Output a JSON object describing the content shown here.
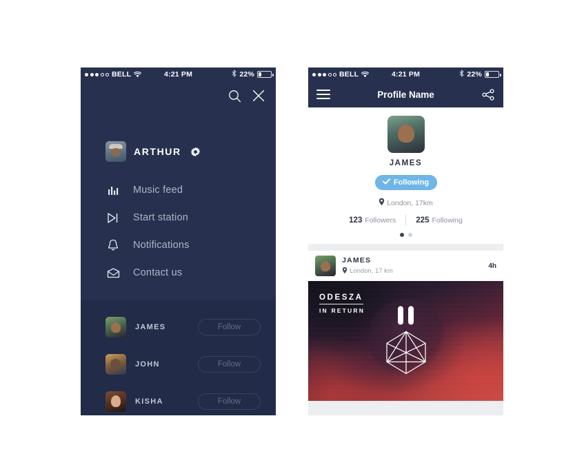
{
  "status_bar": {
    "signal_dots_filled": 3,
    "signal_dots_total": 5,
    "carrier": "BELL",
    "time": "4:21 PM",
    "battery_percent": "22%",
    "wifi_icon": "wifi-icon",
    "bluetooth_icon": "bluetooth-icon",
    "battery_icon": "battery-icon"
  },
  "menu_screen": {
    "search_icon": "search-icon",
    "close_icon": "close-icon",
    "user": {
      "name": "ARTHUR",
      "avatar": "arthur-avatar",
      "settings_icon": "gear-icon"
    },
    "nav_items": [
      {
        "label": "Music feed",
        "icon": "equalizer-icon"
      },
      {
        "label": "Start station",
        "icon": "play-next-icon"
      },
      {
        "label": "Notifications",
        "icon": "bell-icon"
      },
      {
        "label": "Contact us",
        "icon": "envelope-icon"
      }
    ],
    "suggestions": [
      {
        "name": "JAMES",
        "button": "Follow",
        "avatar": "james-avatar"
      },
      {
        "name": "JOHN",
        "button": "Follow",
        "avatar": "john-avatar"
      },
      {
        "name": "KISHA",
        "button": "Follow",
        "avatar": "kisha-avatar"
      }
    ]
  },
  "profile_screen": {
    "navbar": {
      "menu_icon": "hamburger-icon",
      "title": "Profile Name",
      "share_icon": "share-icon"
    },
    "profile": {
      "avatar": "james-avatar",
      "name": "JAMES",
      "follow_button": "Following",
      "follow_button_icon": "check-icon",
      "location_icon": "location-pin-icon",
      "location": "London, 17km",
      "followers_count": "123",
      "followers_label": "Followers",
      "following_count": "225",
      "following_label": "Following",
      "pager_active_index": 0,
      "pager_count": 2
    },
    "post": {
      "avatar": "james-avatar",
      "author": "JAMES",
      "location_icon": "location-pin-icon",
      "location": "London, 17 km",
      "time": "4h",
      "artwork": {
        "artist": "ODESZA",
        "album": "IN RETURN",
        "player_state_icon": "pause-icon",
        "logo_icon": "icosahedron-logo-icon"
      }
    }
  },
  "colors": {
    "sidebar_bg": "#27314f",
    "sidebar_list_bg": "#222b47",
    "navbar_bg": "#27314f",
    "accent_blue": "#6fb5e8",
    "page_bg": "#eceef0",
    "menu_label": "#aeb5c8"
  }
}
